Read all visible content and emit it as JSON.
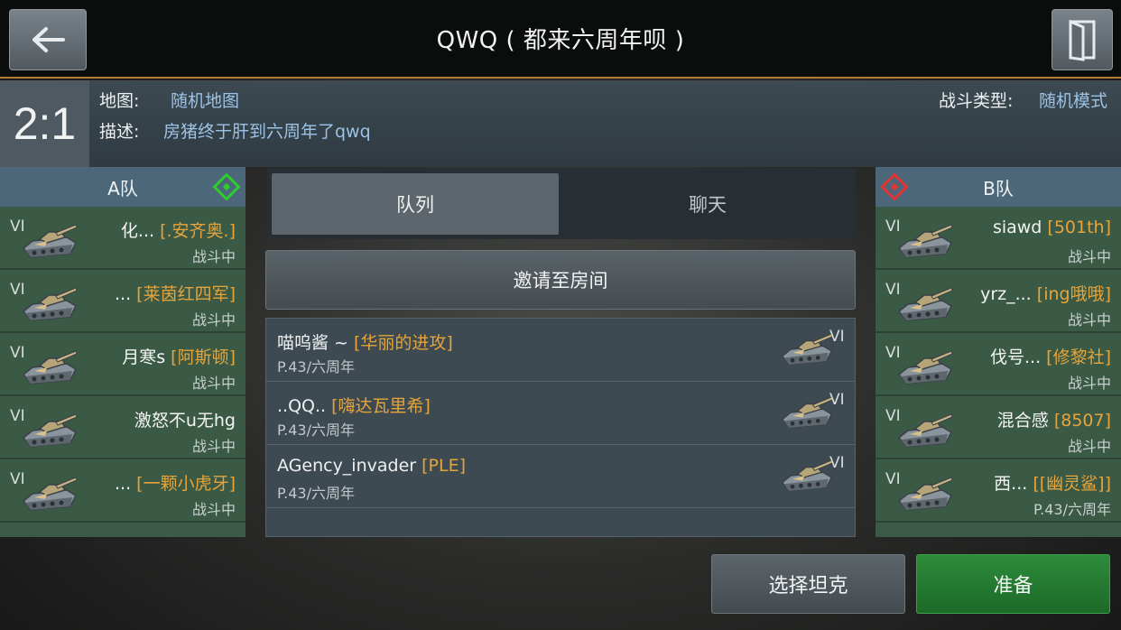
{
  "header": {
    "title": "QWQ ( 都来六周年呗 )",
    "back_icon": "arrow-left-icon",
    "exit_icon": "door-exit-icon"
  },
  "info": {
    "score": "2:1",
    "map_label": "地图:",
    "map_value": "随机地图",
    "desc_label": "描述:",
    "desc_value": "房猪终于肝到六周年了qwq",
    "mode_label": "战斗类型:",
    "mode_value": "随机模式"
  },
  "team_a": {
    "name": "A队",
    "marker_color": "#2ecc2e",
    "rows": [
      {
        "tier": "VI",
        "name": "化...",
        "clan": "[.安齐奥.]",
        "status": "战斗中"
      },
      {
        "tier": "VI",
        "name": "...",
        "clan": "[莱茵红四军]",
        "status": "战斗中"
      },
      {
        "tier": "VI",
        "name": "月寒s",
        "clan": "[阿斯顿]",
        "status": "战斗中"
      },
      {
        "tier": "VI",
        "name": "激怒不u无hg",
        "clan": "",
        "status": "战斗中"
      },
      {
        "tier": "VI",
        "name": "...",
        "clan": "[一颗小虎牙]",
        "status": "战斗中"
      }
    ]
  },
  "team_b": {
    "name": "B队",
    "marker_color": "#e53333",
    "rows": [
      {
        "tier": "VI",
        "name": "siawd",
        "clan": "[501th]",
        "status": "战斗中"
      },
      {
        "tier": "VI",
        "name": "yrz_...",
        "clan": "[ing哦哦]",
        "status": "战斗中"
      },
      {
        "tier": "VI",
        "name": "伐号...",
        "clan": "[修黎社]",
        "status": "战斗中"
      },
      {
        "tier": "VI",
        "name": "混合感",
        "clan": "[8507]",
        "status": "战斗中"
      },
      {
        "tier": "VI",
        "name": "西...",
        "clan": "[[幽灵鲨]]",
        "status": "P.43/六周年"
      }
    ]
  },
  "tabs": {
    "queue": "队列",
    "chat": "聊天"
  },
  "invite_label": "邀请至房间",
  "queue": [
    {
      "name": "喵呜酱 ~",
      "clan": "[华丽的进攻]",
      "sub": "P.43/六周年",
      "tier": "VI"
    },
    {
      "name": "..QQ..",
      "clan": "[嗨达瓦里希]",
      "sub": "P.43/六周年",
      "tier": "VI"
    },
    {
      "name": "AGency_invader",
      "clan": "[PLE]",
      "sub": "P.43/六周年",
      "tier": "VI"
    }
  ],
  "buttons": {
    "select_tank": "选择坦克",
    "ready": "准备"
  }
}
